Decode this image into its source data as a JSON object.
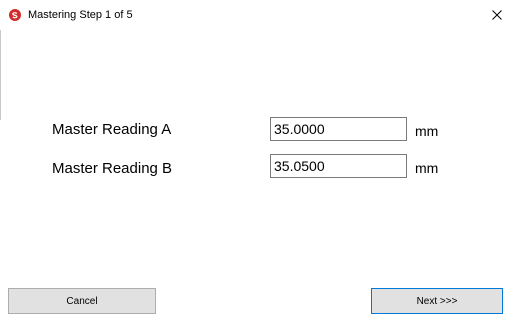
{
  "window": {
    "title": "Mastering Step 1 of 5",
    "close_symbol": "×"
  },
  "form": {
    "reading_a_label": "Master Reading A",
    "reading_a_value": "35.0000",
    "reading_a_unit": "mm",
    "reading_b_label": "Master Reading B",
    "reading_b_value": "35.0500",
    "reading_b_unit": "mm"
  },
  "buttons": {
    "cancel_label": "Cancel",
    "next_label": "Next >>>"
  },
  "icons": {
    "app": "app-logo-icon",
    "close": "close-icon"
  },
  "colors": {
    "app_icon": "#d22c2c",
    "default_button_border": "#0078d7"
  }
}
